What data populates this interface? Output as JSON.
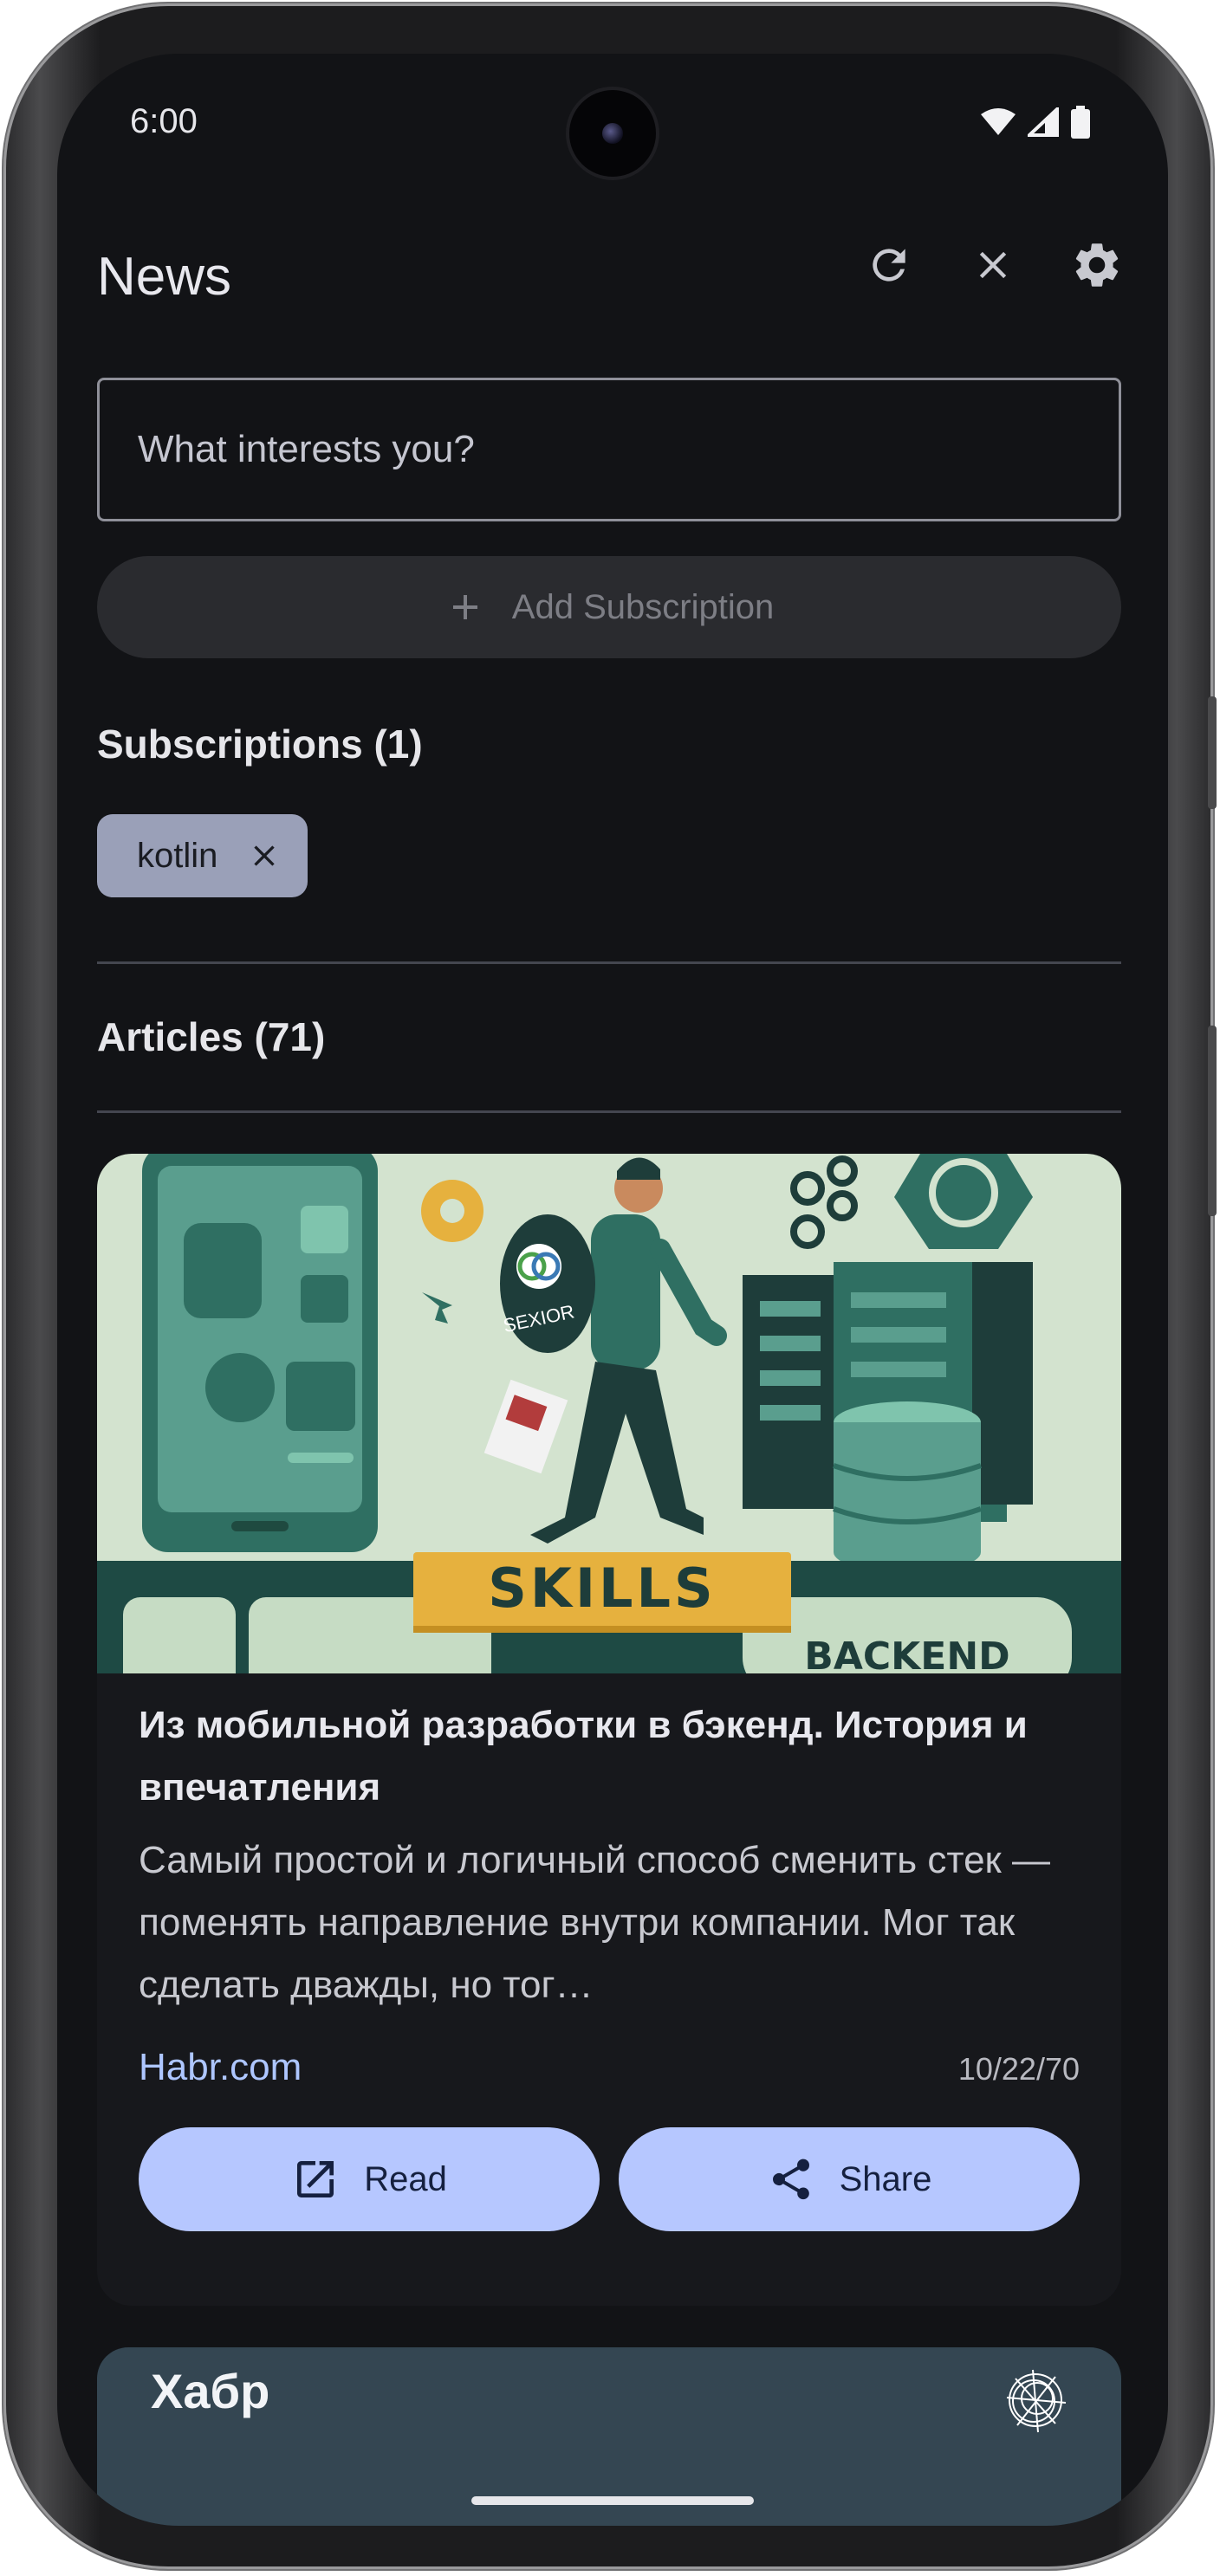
{
  "status_bar": {
    "time": "6:00"
  },
  "app_bar": {
    "title": "News",
    "actions": [
      "refresh-icon",
      "close-icon",
      "settings-icon"
    ]
  },
  "search": {
    "placeholder": "What interests you?",
    "value": ""
  },
  "add_subscription": {
    "label": "Add Subscription",
    "icon": "plus-icon"
  },
  "subscriptions": {
    "heading": "Subscriptions (1)",
    "chips": [
      {
        "label": "kotlin"
      }
    ]
  },
  "articles": {
    "heading": "Articles (71)",
    "items": [
      {
        "image_text": {
          "skills": "SKILLS",
          "backend": "BACKEND",
          "bag": "SEXIOR"
        },
        "title": "Из мобильной разработки в бэкенд. История и впечатления",
        "description": "Самый простой и логичный способ сменить стек — поменять направление внутри компании. Мог так сделать дважды, но тог…",
        "source": "Habr.com",
        "date": "10/22/70",
        "read_label": "Read",
        "share_label": "Share"
      },
      {
        "title": "Хабр"
      }
    ]
  },
  "colors": {
    "background": "#121316",
    "accent": "#b6c7ff",
    "chip": "#9aa0b8",
    "link": "#aec6ff"
  }
}
